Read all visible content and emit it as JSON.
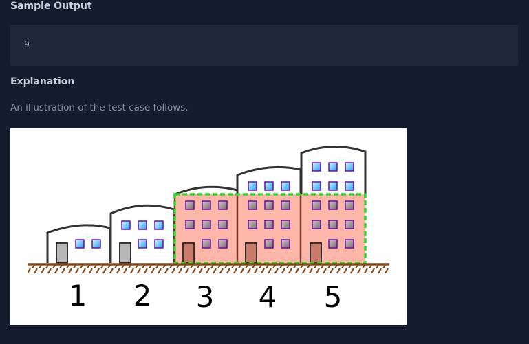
{
  "sample_output": {
    "heading": "Sample Output",
    "value": "9"
  },
  "explanation": {
    "heading": "Explanation",
    "text": "An illustration of the test case follows."
  },
  "illustration": {
    "building_labels": [
      "1",
      "2",
      "3",
      "4",
      "5"
    ],
    "colors": {
      "background": "#141d2e",
      "code_block": "#1f2639",
      "highlight_fill": "#fcb7a8",
      "highlight_border": "#22dd22",
      "ground": "#8b4513"
    }
  }
}
